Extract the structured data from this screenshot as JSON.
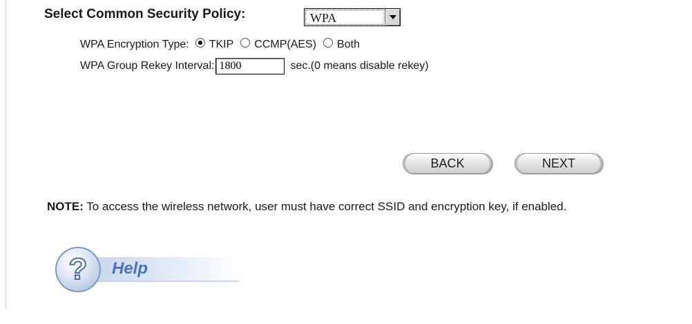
{
  "policy": {
    "label": "Select Common Security Policy:",
    "selected": "WPA"
  },
  "encryption": {
    "label": "WPA Encryption Type:",
    "options": [
      {
        "label": "TKIP",
        "checked": true
      },
      {
        "label": "CCMP(AES)",
        "checked": false
      },
      {
        "label": "Both",
        "checked": false
      }
    ]
  },
  "rekey": {
    "label": "WPA Group Rekey Interval:",
    "value": "1800",
    "hint": "sec.(0 means disable rekey)"
  },
  "buttons": {
    "back": "BACK",
    "next": "NEXT"
  },
  "note": {
    "prefix": "NOTE:",
    "text": " To access the wireless network, user must have correct SSID and encryption key, if enabled."
  },
  "help": {
    "label": "Help",
    "icon": "help-question-icon"
  }
}
